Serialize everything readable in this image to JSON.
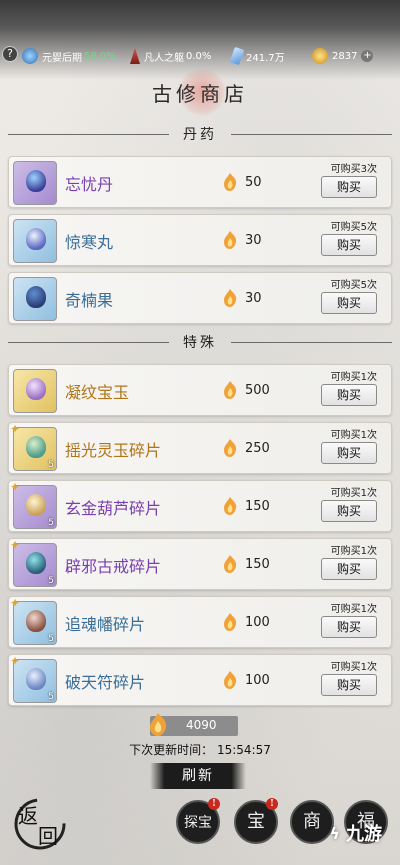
{
  "status": {
    "cultivation": "元婴后期",
    "cultivation_pct": "58.0%",
    "body_realm": "凡人之躯",
    "body_pct": "0.0%",
    "spirit_stones": "241.7万",
    "gold": "2837"
  },
  "title": "古修商店",
  "sections": {
    "pills": "丹药",
    "special": "特殊"
  },
  "items": [
    {
      "name": "忘忧丹",
      "price": "50",
      "limit": "可购买3次",
      "buy": "购买",
      "color": "#7a3fb0"
    },
    {
      "name": "惊寒丸",
      "price": "30",
      "limit": "可购买5次",
      "buy": "购买",
      "color": "#3a6e98"
    },
    {
      "name": "奇楠果",
      "price": "30",
      "limit": "可购买5次",
      "buy": "购买",
      "color": "#3a6e98"
    },
    {
      "name": "凝纹宝玉",
      "price": "500",
      "limit": "可购买1次",
      "buy": "购买",
      "color": "#b07518"
    },
    {
      "name": "摇光灵玉碎片",
      "price": "250",
      "limit": "可购买1次",
      "buy": "购买",
      "color": "#b07518",
      "qty": "5"
    },
    {
      "name": "玄金葫芦碎片",
      "price": "150",
      "limit": "可购买1次",
      "buy": "购买",
      "color": "#7a3fb0",
      "qty": "5"
    },
    {
      "name": "辟邪古戒碎片",
      "price": "150",
      "limit": "可购买1次",
      "buy": "购买",
      "color": "#7a3fb0",
      "qty": "5"
    },
    {
      "name": "追魂幡碎片",
      "price": "100",
      "limit": "可购买1次",
      "buy": "购买",
      "color": "#3a6e98",
      "qty": "5"
    },
    {
      "name": "破天符碎片",
      "price": "100",
      "limit": "可购买1次",
      "buy": "购买",
      "color": "#3a6e98",
      "qty": "5"
    }
  ],
  "currency": "4090",
  "refresh_time_label": "下次更新时间：",
  "refresh_time": "15:54:57",
  "refresh_button": "刷新",
  "back_button": [
    "返",
    "回"
  ],
  "bottom_tabs": [
    "探宝",
    "宝",
    "商",
    "福"
  ],
  "watermark": "九游",
  "help_icon": "?"
}
